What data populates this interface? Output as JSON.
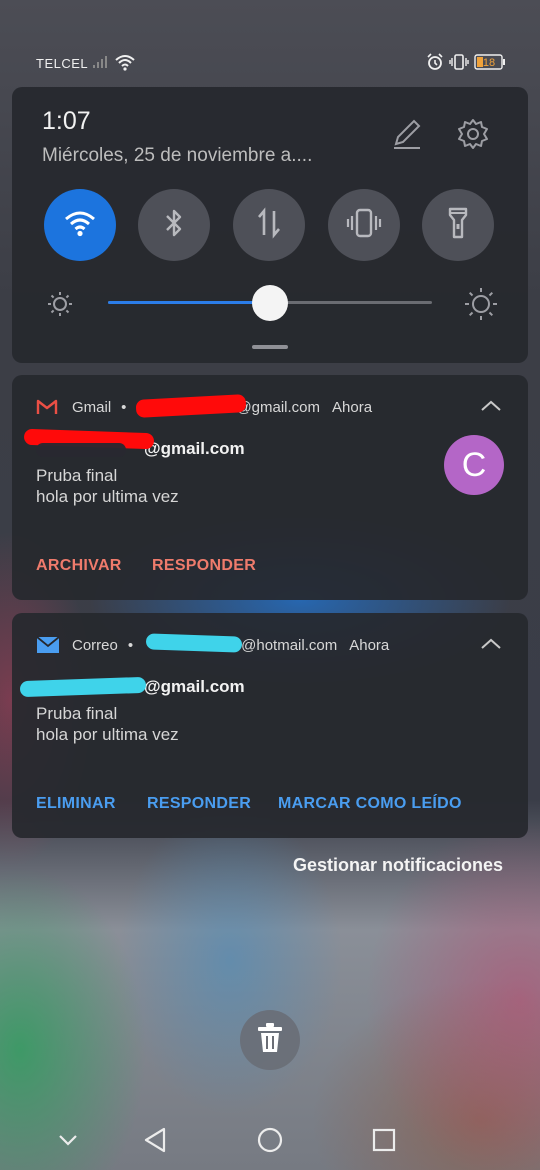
{
  "status_bar": {
    "carrier": "TELCEL",
    "battery": "18",
    "icons": [
      "signal-icon",
      "wifi-icon",
      "alarm-icon",
      "vibrate-icon",
      "battery-icon"
    ]
  },
  "quick_settings": {
    "time": "1:07",
    "date": "Miércoles, 25 de noviembre  a....",
    "toggles": [
      {
        "name": "wifi",
        "active": true
      },
      {
        "name": "bluetooth",
        "active": false
      },
      {
        "name": "mobile-data",
        "active": false
      },
      {
        "name": "vibrate",
        "active": false
      },
      {
        "name": "flashlight",
        "active": false
      }
    ],
    "brightness": 0.5
  },
  "notifications": [
    {
      "app": "Gmail",
      "account_suffix": "@gmail.com",
      "time": "Ahora",
      "title_suffix": "@gmail.com",
      "subject": "Pruba final",
      "body": "hola por ultima vez",
      "avatar_letter": "C",
      "actions": [
        "ARCHIVAR",
        "RESPONDER"
      ],
      "action_color": "#ef7b6c"
    },
    {
      "app": "Correo",
      "account_suffix": "@hotmail.com",
      "time": "Ahora",
      "title_suffix": "@gmail.com",
      "subject": "Pruba final",
      "body": "hola por ultima vez",
      "actions": [
        "ELIMINAR",
        "RESPONDER",
        "MARCAR COMO LEÍDO"
      ],
      "action_color": "#4a9df0"
    }
  ],
  "manage_notifications": "Gestionar notificaciones",
  "colors": {
    "accent": "#1c74de",
    "gmail_action": "#ef7b6c",
    "correo_action": "#4a9df0",
    "avatar": "#b466c7",
    "redact_red": "#ff0a0a",
    "redact_cyan": "#3fd3ea"
  }
}
